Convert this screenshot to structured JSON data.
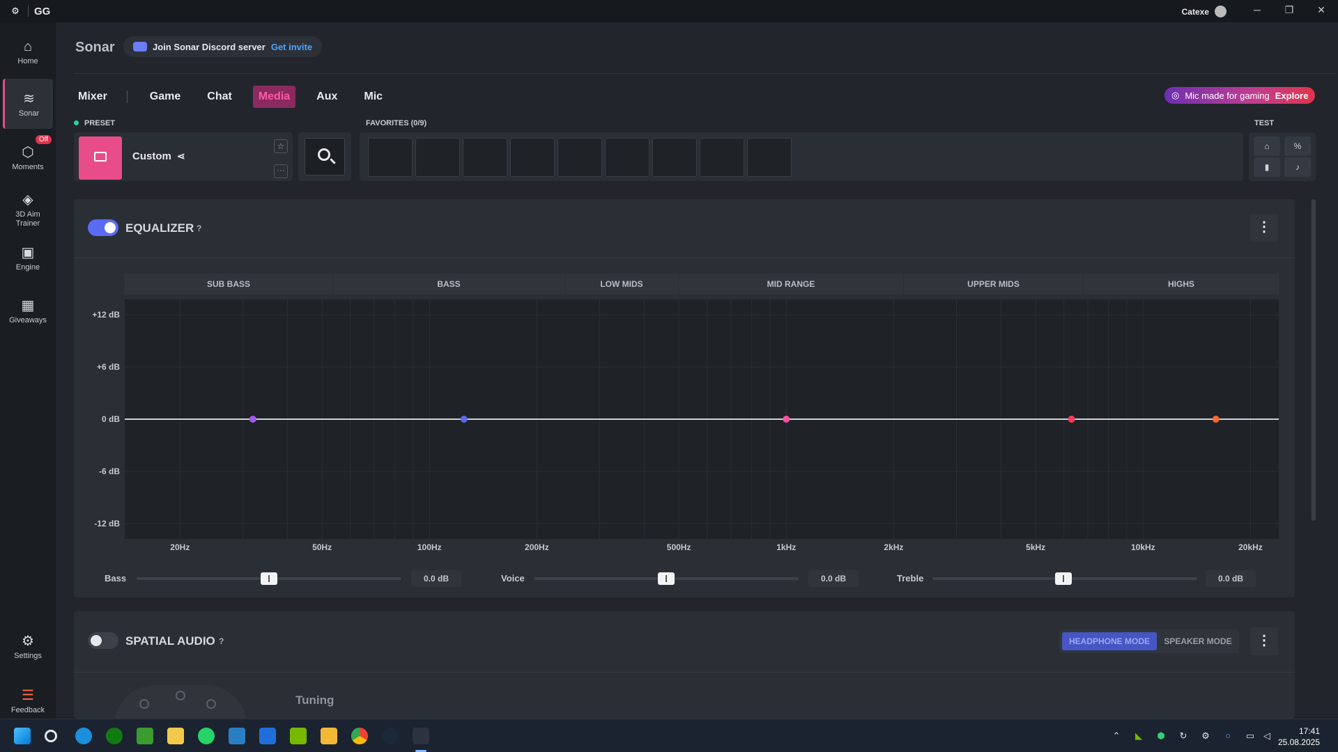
{
  "titlebar": {
    "app": "GG",
    "user": "Catexe"
  },
  "sidebar": {
    "items": [
      {
        "label": "Home",
        "icon": "home-icon"
      },
      {
        "label": "Sonar",
        "icon": "sonar-icon"
      },
      {
        "label": "Moments",
        "icon": "moments-icon",
        "badge": "Off"
      },
      {
        "label": "3D Aim Trainer",
        "icon": "aim-trainer-icon"
      },
      {
        "label": "Engine",
        "icon": "engine-icon"
      },
      {
        "label": "Giveaways",
        "icon": "giveaways-icon"
      },
      {
        "label": "Settings",
        "icon": "gear-icon"
      },
      {
        "label": "Feedback",
        "icon": "feedback-icon"
      }
    ]
  },
  "header": {
    "title": "Sonar",
    "discord_text": "Join Sonar Discord server",
    "discord_link": "Get invite"
  },
  "tabs": [
    "Mixer",
    "Game",
    "Chat",
    "Media",
    "Aux",
    "Mic"
  ],
  "active_tab": "Media",
  "promo": {
    "text": "Mic made for gaming",
    "link": "Explore"
  },
  "preset": {
    "label": "PRESET",
    "name": "Custom"
  },
  "favorites": {
    "label": "FAVORITES (0/9)",
    "slots": 9
  },
  "test": {
    "label": "TEST"
  },
  "equalizer": {
    "title": "EQUALIZER",
    "help": "?",
    "enabled": true,
    "bands": [
      "SUB BASS",
      "BASS",
      "LOW MIDS",
      "MID RANGE",
      "UPPER MIDS",
      "HIGHS"
    ],
    "db_labels": [
      "+12 dB",
      "+6 dB",
      "0 dB",
      "-6 dB",
      "-12 dB"
    ],
    "freq_labels": [
      "20Hz",
      "50Hz",
      "100Hz",
      "200Hz",
      "500Hz",
      "1kHz",
      "2kHz",
      "5kHz",
      "10kHz",
      "20kHz"
    ],
    "points": [
      {
        "freq_hz": 32,
        "gain_db": 0,
        "color": "#a259f0"
      },
      {
        "freq_hz": 125,
        "gain_db": 0,
        "color": "#5a6cf5"
      },
      {
        "freq_hz": 1000,
        "gain_db": 0,
        "color": "#ff4fa0"
      },
      {
        "freq_hz": 6300,
        "gain_db": 0,
        "color": "#ff3e5c"
      },
      {
        "freq_hz": 16000,
        "gain_db": 0,
        "color": "#ff6a2e"
      }
    ],
    "sliders": [
      {
        "label": "Bass",
        "value": "0.0 dB",
        "position": 0.5
      },
      {
        "label": "Voice",
        "value": "0.0 dB",
        "position": 0.5
      },
      {
        "label": "Treble",
        "value": "0.0 dB",
        "position": 0.5
      }
    ]
  },
  "spatial": {
    "title": "SPATIAL AUDIO",
    "help": "?",
    "enabled": false,
    "headphone_mode": "HEADPHONE MODE",
    "speaker_mode": "SPEAKER MODE",
    "tuning": "Tuning"
  },
  "clock": {
    "time": "17:41",
    "date": "25.08.2025"
  },
  "colors": {
    "accent": "#e84d8a",
    "toggle_on": "#5a6cf5"
  }
}
